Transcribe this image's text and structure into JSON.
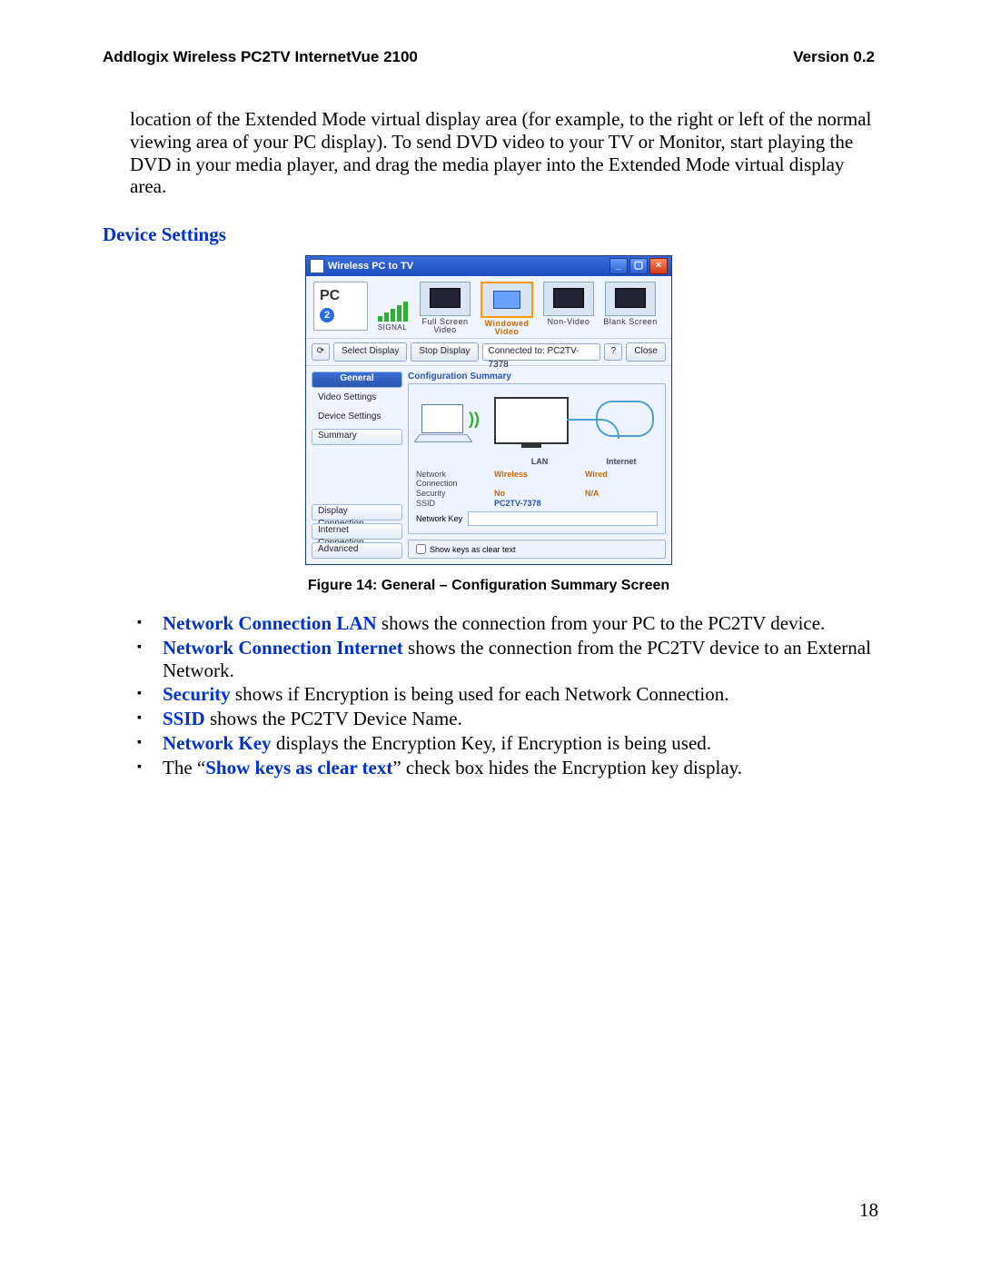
{
  "doc": {
    "header_left": "Addlogix Wireless PC2TV InternetVue 2100",
    "header_right": "Version 0.2",
    "page_number": "18",
    "continuation_para": "location of the Extended Mode virtual display area (for example, to the right or left of the normal viewing area of your PC display). To send DVD video to your TV or Monitor, start playing the DVD in your media player, and drag the media player into the Extended Mode virtual display area.",
    "section_title": "Device Settings",
    "figure_caption": "Figure 14: General – Configuration Summary Screen",
    "bullets": [
      {
        "term": "Network Connection LAN",
        "rest": " shows the connection from your PC to the PC2TV device."
      },
      {
        "term": "Network Connection Internet",
        "rest": " shows the connection from the PC2TV device to an External Network."
      },
      {
        "term": "Security",
        "rest": " shows if Encryption is being used for each Network Connection."
      },
      {
        "term": "SSID",
        "rest": " shows the PC2TV Device Name."
      },
      {
        "term": "Network Key",
        "rest": " displays the Encryption Key, if Encryption is being used."
      },
      {
        "prefix": "The “",
        "term": "Show keys as clear text",
        "suffix": "” check box hides the Encryption key display."
      }
    ]
  },
  "app": {
    "title": "Wireless PC to TV",
    "signal_label": "SIGNAL",
    "modes": [
      {
        "label": "Full Screen\nVideo",
        "selected": false
      },
      {
        "label": "Windowed\nVideo",
        "selected": true,
        "orange": true
      },
      {
        "label": "Non-Video",
        "selected": false
      },
      {
        "label": "Blank Screen",
        "selected": false
      }
    ],
    "select_display": "Select Display",
    "stop_display": "Stop Display",
    "status": "Connected to: PC2TV-7378",
    "close": "Close",
    "side_top": [
      "General",
      "Video Settings",
      "Device Settings",
      "Summary"
    ],
    "side_bottom": [
      "Display Connection",
      "Internet Connection",
      "Advanced"
    ],
    "group_title": "Configuration Summary",
    "cols": {
      "lan": "LAN",
      "internet": "Internet"
    },
    "rows": {
      "network_connection": {
        "label": "Network\nConnection",
        "lan": "Wireless",
        "internet": "Wired"
      },
      "security": {
        "label": "Security",
        "lan": "No",
        "internet": "N/A"
      },
      "ssid": {
        "label": "SSID",
        "value": "PC2TV-7378"
      },
      "network_key": {
        "label": "Network Key",
        "value": ""
      }
    },
    "show_keys": "Show keys as clear text"
  }
}
